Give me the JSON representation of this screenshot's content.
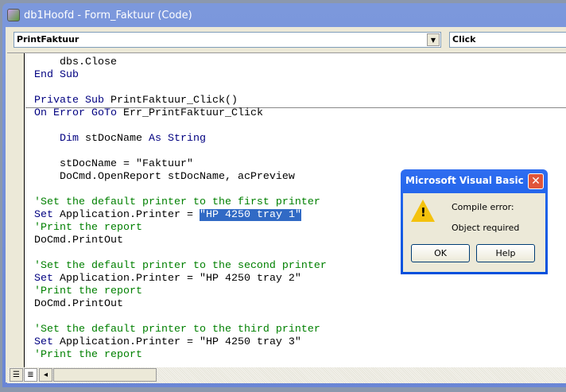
{
  "window": {
    "title": "db1Hoofd - Form_Faktuur (Code)"
  },
  "object_combo": "PrintFaktuur",
  "procedure_combo": "Click",
  "code": [
    [
      [
        "    dbs.Close",
        "n"
      ]
    ],
    [
      [
        "End Sub",
        "k"
      ]
    ],
    [
      [
        "",
        ""
      ]
    ],
    [
      [
        "Private Sub",
        "k"
      ],
      [
        " PrintFaktuur_Click()",
        "n"
      ]
    ],
    [
      [
        "On Error GoTo",
        "k"
      ],
      [
        " Err_PrintFaktuur_Click",
        "n"
      ]
    ],
    [
      [
        "",
        ""
      ]
    ],
    [
      [
        "    Dim",
        "k"
      ],
      [
        " stDocName ",
        "n"
      ],
      [
        "As String",
        "k"
      ]
    ],
    [
      [
        "",
        ""
      ]
    ],
    [
      [
        "    stDocName = \"Faktuur\"",
        "n"
      ]
    ],
    [
      [
        "    DoCmd.OpenReport stDocName, acPreview",
        "n"
      ]
    ],
    [
      [
        "",
        ""
      ]
    ],
    [
      [
        "'Set the default printer to the first printer",
        "c"
      ]
    ],
    [
      [
        "Set",
        "k"
      ],
      [
        " Application.Printer = ",
        "n"
      ],
      [
        "\"HP 4250 tray 1\"",
        "s"
      ]
    ],
    [
      [
        "'Print the report",
        "c"
      ]
    ],
    [
      [
        "DoCmd.PrintOut",
        "n"
      ]
    ],
    [
      [
        "",
        ""
      ]
    ],
    [
      [
        "'Set the default printer to the second printer",
        "c"
      ]
    ],
    [
      [
        "Set",
        "k"
      ],
      [
        " Application.Printer = \"HP 4250 tray 2\"",
        "n"
      ]
    ],
    [
      [
        "'Print the report",
        "c"
      ]
    ],
    [
      [
        "DoCmd.PrintOut",
        "n"
      ]
    ],
    [
      [
        "",
        ""
      ]
    ],
    [
      [
        "'Set the default printer to the third printer",
        "c"
      ]
    ],
    [
      [
        "Set",
        "k"
      ],
      [
        " Application.Printer = \"HP 4250 tray 3\"",
        "n"
      ]
    ],
    [
      [
        "'Print the report",
        "c"
      ]
    ]
  ],
  "dialog": {
    "title": "Microsoft Visual Basic",
    "line1": "Compile error:",
    "line2": "Object required",
    "ok": "OK",
    "help": "Help",
    "icon": "warning-icon"
  }
}
